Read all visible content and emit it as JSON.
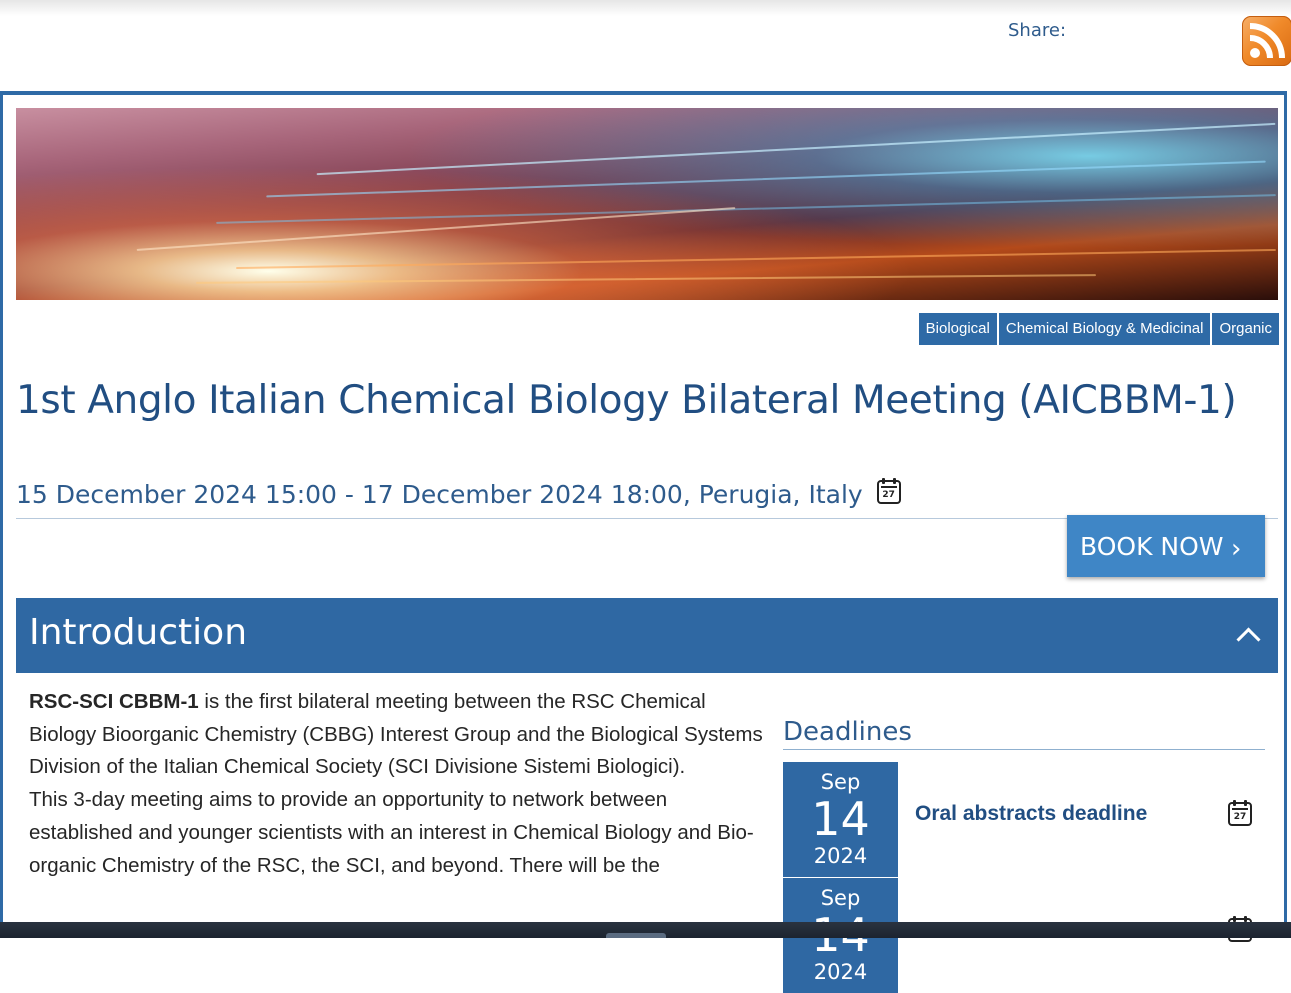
{
  "header": {
    "share_label": "Share:",
    "rss_icon": "rss-feed-icon"
  },
  "tags": [
    "Biological",
    "Chemical Biology & Medicinal",
    "Organic"
  ],
  "event": {
    "title": "1st Anglo Italian Chemical Biology Bilateral Meeting (AICBBM-1)",
    "dates": "15 December 2024 15:00 - 17 December 2024 18:00, Perugia, Italy",
    "calendar_icon_number": "27",
    "book_label": "BOOK NOW",
    "book_chevron": "›"
  },
  "introduction": {
    "heading": "Introduction",
    "lead_bold": "RSC-SCI CBBM-1",
    "lead_rest": " is the first bilateral meeting between the RSC Chemical Biology Bioorganic Chemistry (CBBG) Interest Group and the Biological Systems Division of the Italian Chemical Society (SCI Divisione Sistemi Biologici).",
    "paragraph2": "This 3-day meeting aims to provide an opportunity to network between established and younger scientists with an interest in Chemical Biology and Bio-organic Chemistry of the RSC, the SCI, and beyond. There will be the"
  },
  "deadlines": {
    "heading": "Deadlines",
    "items": [
      {
        "month": "Sep",
        "day": "14",
        "year": "2024",
        "label": "Oral abstracts deadline",
        "cal": "27"
      },
      {
        "month": "Sep",
        "day": "14",
        "year": "2024",
        "label": "",
        "cal": "27"
      }
    ]
  },
  "colors": {
    "brand_blue": "#2f68a3",
    "title_blue": "#214e82",
    "button_blue": "#3f86c6",
    "rss_orange": "#f08a2a"
  }
}
